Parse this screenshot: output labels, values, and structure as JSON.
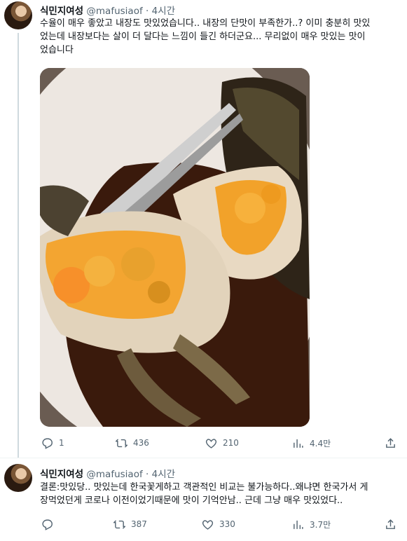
{
  "tweets": [
    {
      "author_name": "식민지여성",
      "handle": "@mafusiaof",
      "separator": "·",
      "time": "4시간",
      "text_lines": [
        "수율이 매우 좋았고 내장도 맛있었습니다.. 내장의 단맛이 부족한가..? 이미 충분히 맛있",
        "었는데 내장보다는 살이 더 달다는 느낌이 들긴 하더군요... 무리없이 매우 맛있는 맛이",
        "었습니다"
      ],
      "replies": "1",
      "retweets": "436",
      "likes": "210",
      "views": "4.4만"
    },
    {
      "author_name": "식민지여성",
      "handle": "@mafusiaof",
      "separator": "·",
      "time": "4시간",
      "text_lines": [
        "결론:맛있당.. 맛있는데 한국꽃게하고 객관적인 비교는 불가능하다..왜냐면 한국가서 게",
        "장먹었던게 코로나 이전이었기때문에 맛이 기억안남.. 근데 그냥 매우 맛있었다.."
      ],
      "replies": "",
      "retweets": "387",
      "likes": "330",
      "views": "3.7만"
    }
  ],
  "icons": {
    "reply": "reply-icon",
    "retweet": "retweet-icon",
    "like": "heart-icon",
    "views": "views-icon",
    "share": "share-icon"
  },
  "colors": {
    "text": "#0f1419",
    "secondary": "#536471",
    "thread_line": "#cfd9de"
  }
}
